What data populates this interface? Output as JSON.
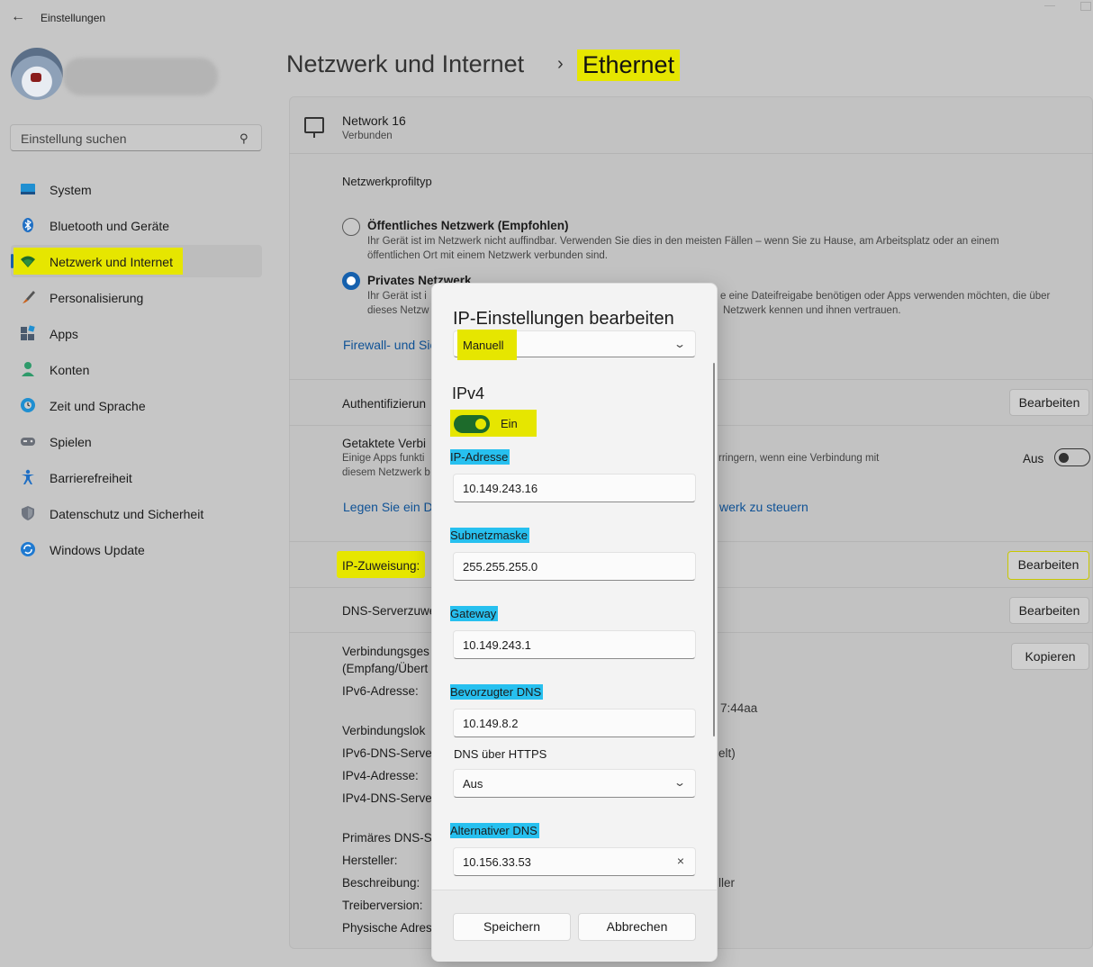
{
  "window": {
    "title": "Einstellungen",
    "back_icon": "arrow-left-icon"
  },
  "search": {
    "placeholder": "Einstellung suchen"
  },
  "sidebar": {
    "items": [
      {
        "label": "System",
        "icon": "monitor-icon"
      },
      {
        "label": "Bluetooth und Geräte",
        "icon": "bluetooth-icon"
      },
      {
        "label": "Netzwerk und Internet",
        "icon": "wifi-icon",
        "active": true
      },
      {
        "label": "Personalisierung",
        "icon": "brush-icon"
      },
      {
        "label": "Apps",
        "icon": "apps-icon"
      },
      {
        "label": "Konten",
        "icon": "person-icon"
      },
      {
        "label": "Zeit und Sprache",
        "icon": "globe-clock-icon"
      },
      {
        "label": "Spielen",
        "icon": "gamepad-icon"
      },
      {
        "label": "Barrierefreiheit",
        "icon": "accessibility-icon"
      },
      {
        "label": "Datenschutz und Sicherheit",
        "icon": "shield-icon"
      },
      {
        "label": "Windows Update",
        "icon": "update-icon"
      }
    ]
  },
  "header": {
    "parent": "Netzwerk und Internet",
    "separator": "›",
    "current": "Ethernet"
  },
  "network": {
    "name": "Network 16",
    "status": "Verbunden"
  },
  "profile": {
    "heading": "Netzwerkprofiltyp",
    "public_title": "Öffentliches Netzwerk (Empfohlen)",
    "public_desc_1": "Ihr Gerät ist im Netzwerk nicht auffindbar. Verwenden Sie dies in den meisten Fällen – wenn Sie zu Hause, am Arbeitsplatz oder an einem",
    "public_desc_2": "öffentlichen Ort mit einem Netzwerk verbunden sind.",
    "private_title": "Privates Netzwerk",
    "private_desc_1a": "Ihr Gerät ist i",
    "private_desc_1b": "e eine Dateifreigabe benötigen oder Apps verwenden möchten, die über",
    "private_desc_2a": "dieses Netzw",
    "private_desc_2b": "Netzwerk kennen und ihnen vertrauen.",
    "firewall_link": "Firewall- und Sic"
  },
  "auth": {
    "label": "Authentifizierun",
    "button": "Bearbeiten"
  },
  "metered": {
    "label": "Getaktete Verbi",
    "desc_1a": "Einige Apps funkti",
    "desc_1b": "rringern, wenn eine Verbindung mit",
    "desc_2": "diesem Netzwerk b",
    "toggle_state": "Aus",
    "link_a": "Legen Sie ein Da",
    "link_b": "werk zu steuern"
  },
  "ip_assignment": {
    "label": "IP-Zuweisung:",
    "button": "Bearbeiten"
  },
  "dns_assignment": {
    "label": "DNS-Serverzuwe",
    "button": "Bearbeiten"
  },
  "properties": {
    "copy_button": "Kopieren",
    "link_speed_1": "Verbindungsges",
    "link_speed_2": "(Empfang/Übert",
    "ipv6_address": "IPv6-Adresse:",
    "ipv6_tail": "7:44aa",
    "link_local": "Verbindungslok",
    "ipv6_dns": "IPv6-DNS-Serve",
    "ipv6_dns_tail": "elt)",
    "ipv4_address": "IPv4-Adresse:",
    "ipv4_dns": "IPv4-DNS-Serve",
    "primary_dns": "Primäres DNS-S",
    "manufacturer": "Hersteller:",
    "description": "Beschreibung:",
    "description_tail": "ller",
    "driver_version": "Treiberversion:",
    "physical_address": "Physische Adres"
  },
  "dialog": {
    "title": "IP-Einstellungen bearbeiten",
    "mode_value": "Manuell",
    "ipv4_heading": "IPv4",
    "ipv4_toggle_label": "Ein",
    "ip_label": "IP-Adresse",
    "ip_value": "10.149.243.16",
    "subnet_label": "Subnetzmaske",
    "subnet_value": "255.255.255.0",
    "gateway_label": "Gateway",
    "gateway_value": "10.149.243.1",
    "pref_dns_label": "Bevorzugter DNS",
    "pref_dns_value": "10.149.8.2",
    "doh_label": "DNS über HTTPS",
    "doh_value": "Aus",
    "alt_dns_label": "Alternativer DNS",
    "alt_dns_value": "10.156.33.53",
    "save_button": "Speichern",
    "cancel_button": "Abbrechen"
  }
}
